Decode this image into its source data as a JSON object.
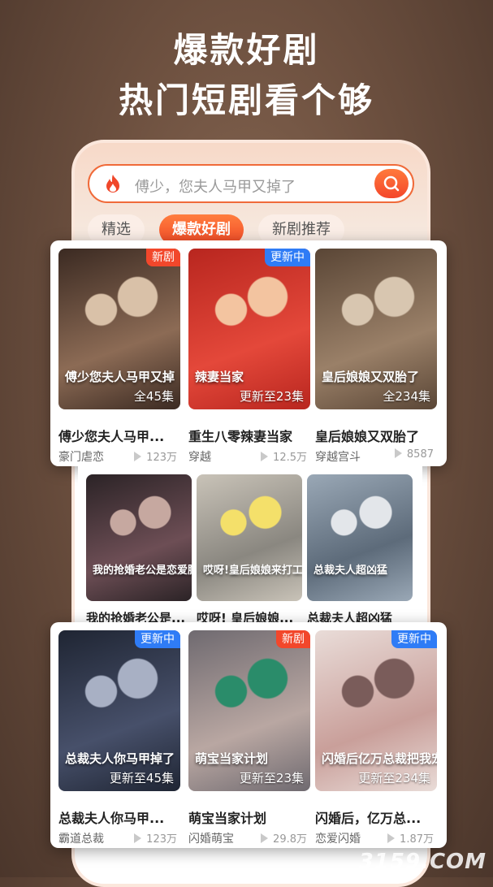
{
  "hero": {
    "line1": "爆款好剧",
    "line2": "热门短剧看个够"
  },
  "search": {
    "placeholder": "傅少，您夫人马甲又掉了"
  },
  "tabs": [
    {
      "label": "精选",
      "active": false
    },
    {
      "label": "爆款好剧",
      "active": true
    },
    {
      "label": "新剧推荐",
      "active": false
    }
  ],
  "rows": [
    [
      {
        "title": "傅少您夫人马甲...",
        "tag": "豪门虐恋",
        "plays": "123万",
        "badge": "新剧",
        "episodes": "全45集",
        "poster_text": "傅少您夫人马甲又掉"
      },
      {
        "title": "重生八零辣妻当家",
        "tag": "穿越",
        "plays": "12.5万",
        "badge": "更新中",
        "episodes": "更新至23集",
        "poster_text": "辣妻当家"
      },
      {
        "title": "皇后娘娘又双胎了",
        "tag": "穿越宫斗",
        "plays": "8587",
        "badge": "",
        "episodes": "全234集",
        "poster_text": "皇后娘娘又双胎了"
      }
    ],
    [
      {
        "title": "我的抢婚老公是...",
        "tag": "",
        "plays": "",
        "badge": "",
        "episodes": "",
        "poster_text": "我的抢婚老公是恋爱脑"
      },
      {
        "title": "哎呀! 皇后娘娘...",
        "tag": "",
        "plays": "",
        "badge": "",
        "episodes": "",
        "poster_text": "哎呀!皇后娘娘来打工"
      },
      {
        "title": "总裁夫人超凶猛",
        "tag": "",
        "plays": "",
        "badge": "",
        "episodes": "",
        "poster_text": "总裁夫人超凶猛"
      }
    ],
    [
      {
        "title": "总裁夫人你马甲...",
        "tag": "霸道总裁",
        "plays": "123万",
        "badge": "更新中",
        "episodes": "更新至45集",
        "poster_text": "总裁夫人你马甲掉了"
      },
      {
        "title": "萌宝当家计划",
        "tag": "闪婚萌宝",
        "plays": "29.8万",
        "badge": "新剧",
        "episodes": "更新至23集",
        "poster_text": "萌宝当家计划"
      },
      {
        "title": "闪婚后，亿万总...",
        "tag": "恋爱闪婚",
        "plays": "1.87万",
        "badge": "更新中",
        "episodes": "更新至234集",
        "poster_text": "闪婚后亿万总裁把我宠上天"
      }
    ]
  ],
  "watermark": "3159.COM"
}
